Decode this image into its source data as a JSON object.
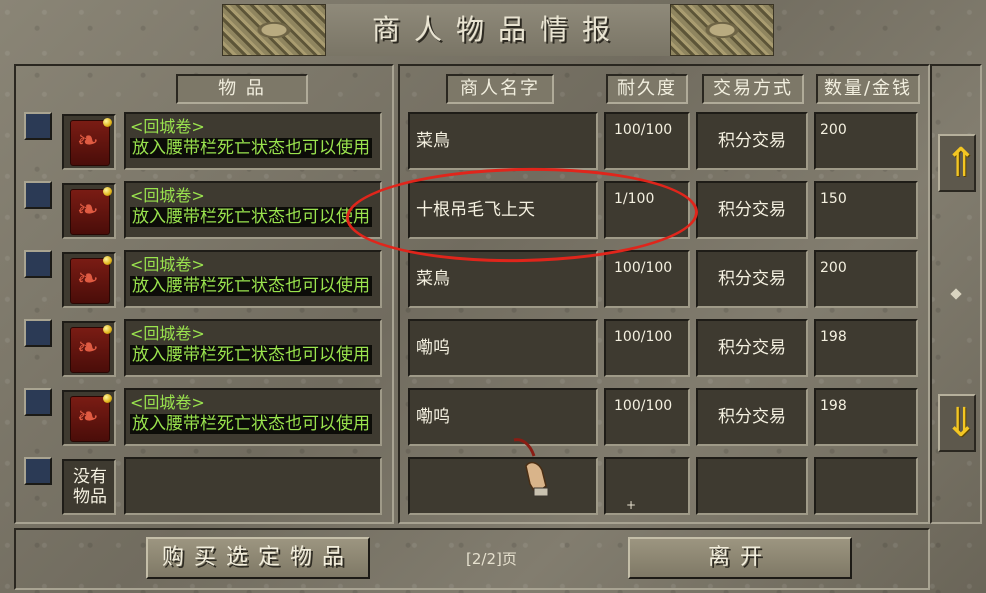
{
  "window": {
    "title": "商人物品情报"
  },
  "headers": {
    "item": "物 品",
    "merchant": "商人名字",
    "durability": "耐久度",
    "trade": "交易方式",
    "qty": "数量/金钱"
  },
  "rows": [
    {
      "item_name": "<回城卷>",
      "item_desc": "放入腰带栏死亡状态也可以使用",
      "merchant": "菜鳥",
      "durability": "100/100",
      "trade": "积分交易",
      "qty": "200"
    },
    {
      "item_name": "<回城卷>",
      "item_desc": "放入腰带栏死亡状态也可以使用",
      "merchant": "十根吊毛飞上天",
      "durability": "1/100",
      "trade": "积分交易",
      "qty": "150"
    },
    {
      "item_name": "<回城卷>",
      "item_desc": "放入腰带栏死亡状态也可以使用",
      "merchant": "菜鳥",
      "durability": "100/100",
      "trade": "积分交易",
      "qty": "200"
    },
    {
      "item_name": "<回城卷>",
      "item_desc": "放入腰带栏死亡状态也可以使用",
      "merchant": "嘞呜",
      "durability": "100/100",
      "trade": "积分交易",
      "qty": "198"
    },
    {
      "item_name": "<回城卷>",
      "item_desc": "放入腰带栏死亡状态也可以使用",
      "merchant": "嘞呜",
      "durability": "100/100",
      "trade": "积分交易",
      "qty": "198"
    }
  ],
  "empty_row": {
    "label": "没有物品"
  },
  "footer": {
    "buy_label": "购买选定物品",
    "page_label": "[2/2]页",
    "leave_label": "离开"
  },
  "icons": {
    "item_icon": "scroll-icon",
    "scroll_up": "key-arrow-up-icon",
    "scroll_down": "key-arrow-down-icon"
  },
  "colors": {
    "item_text": "#9ae34e",
    "highlight_circle": "#e0251b",
    "checkbox": "#2b3a55"
  }
}
